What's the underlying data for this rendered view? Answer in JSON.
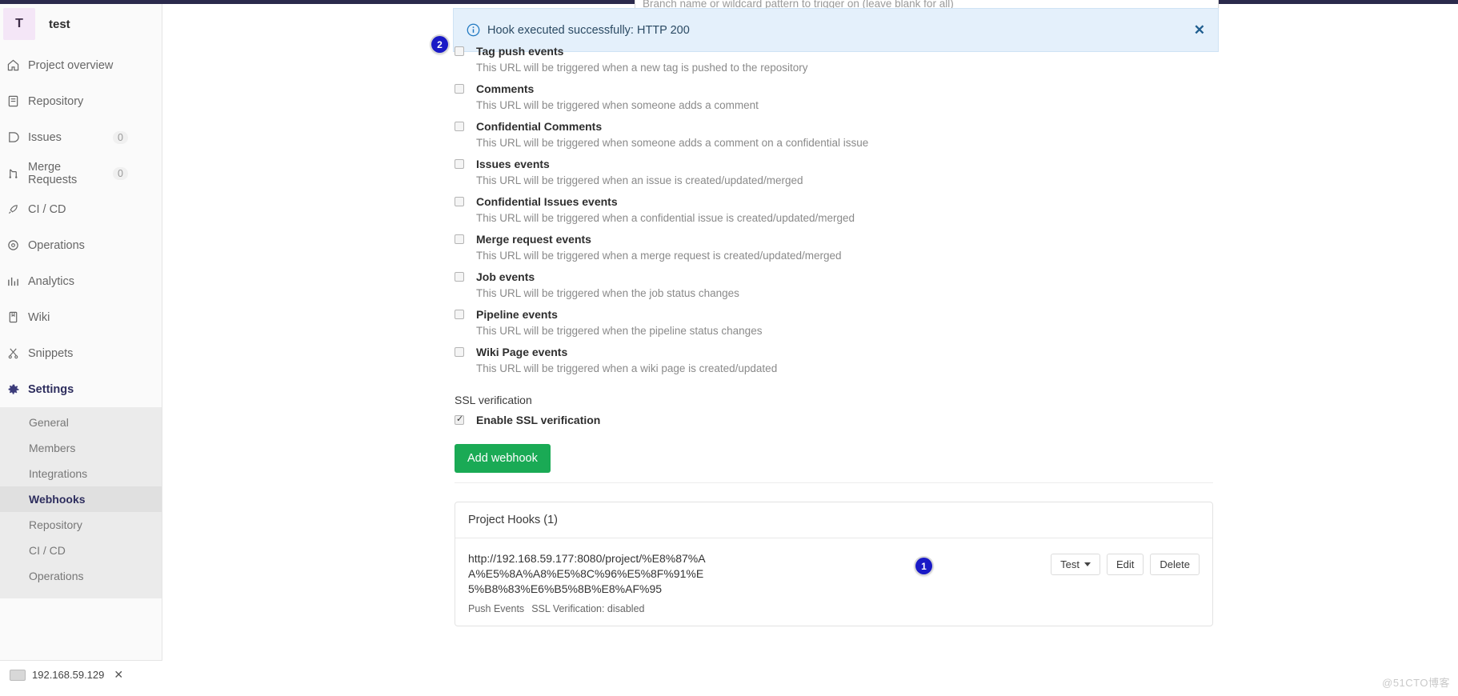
{
  "project": {
    "avatar_letter": "T",
    "name": "test"
  },
  "sidebar": {
    "items": [
      {
        "label": "Project overview",
        "icon": "home-icon",
        "count": ""
      },
      {
        "label": "Repository",
        "icon": "repository-icon",
        "count": ""
      },
      {
        "label": "Issues",
        "icon": "issues-icon",
        "count": "0"
      },
      {
        "label": "Merge Requests",
        "icon": "merge-requests-icon",
        "count": "0"
      },
      {
        "label": "CI / CD",
        "icon": "rocket-icon",
        "count": ""
      },
      {
        "label": "Operations",
        "icon": "cloud-icon",
        "count": ""
      },
      {
        "label": "Analytics",
        "icon": "chart-icon",
        "count": ""
      },
      {
        "label": "Wiki",
        "icon": "book-icon",
        "count": ""
      },
      {
        "label": "Snippets",
        "icon": "scissors-icon",
        "count": ""
      }
    ],
    "settings": {
      "label": "Settings",
      "icon": "gear-icon"
    },
    "sub_items": [
      {
        "label": "General",
        "active": false
      },
      {
        "label": "Members",
        "active": false
      },
      {
        "label": "Integrations",
        "active": false
      },
      {
        "label": "Webhooks",
        "active": true
      },
      {
        "label": "Repository",
        "active": false
      },
      {
        "label": "CI / CD",
        "active": false
      },
      {
        "label": "Operations",
        "active": false
      }
    ]
  },
  "alert": {
    "message": "Hook executed successfully: HTTP 200",
    "icon": "info-circle-icon",
    "close_icon": "close-icon"
  },
  "badges": {
    "one": "1",
    "two": "2"
  },
  "branch_input": {
    "placeholder": "Branch name or wildcard pattern to trigger on (leave blank for all)"
  },
  "trigger_events": [
    {
      "title": "Tag push events",
      "desc": "This URL will be triggered when a new tag is pushed to the repository",
      "checked": false
    },
    {
      "title": "Comments",
      "desc": "This URL will be triggered when someone adds a comment",
      "checked": false
    },
    {
      "title": "Confidential Comments",
      "desc": "This URL will be triggered when someone adds a comment on a confidential issue",
      "checked": false
    },
    {
      "title": "Issues events",
      "desc": "This URL will be triggered when an issue is created/updated/merged",
      "checked": false
    },
    {
      "title": "Confidential Issues events",
      "desc": "This URL will be triggered when a confidential issue is created/updated/merged",
      "checked": false
    },
    {
      "title": "Merge request events",
      "desc": "This URL will be triggered when a merge request is created/updated/merged",
      "checked": false
    },
    {
      "title": "Job events",
      "desc": "This URL will be triggered when the job status changes",
      "checked": false
    },
    {
      "title": "Pipeline events",
      "desc": "This URL will be triggered when the pipeline status changes",
      "checked": false
    },
    {
      "title": "Wiki Page events",
      "desc": "This URL will be triggered when a wiki page is created/updated",
      "checked": false
    }
  ],
  "ssl": {
    "section_label": "SSL verification",
    "checkbox_label": "Enable SSL verification",
    "checked": true
  },
  "add_button": {
    "label": "Add webhook"
  },
  "hooks": {
    "header": "Project Hooks (1)",
    "rows": [
      {
        "url": "http://192.168.59.177:8080/project/%E8%87%AA%E5%8A%A8%E5%8C%96%E5%8F%91%E5%B8%83%E6%B5%8B%E8%AF%95",
        "tags": [
          "Push Events",
          "SSL Verification: disabled"
        ],
        "test_label": "Test",
        "edit_label": "Edit",
        "delete_label": "Delete"
      }
    ]
  },
  "taskbar": {
    "label": "192.168.59.129",
    "close_icon": "close-icon"
  },
  "watermark": "@51CTO博客",
  "colors": {
    "accent_green": "#1aaa55",
    "alert_bg": "#e4f0fb",
    "badge_blue": "#1a1ac6",
    "sidebar_bg": "#fafafa"
  }
}
